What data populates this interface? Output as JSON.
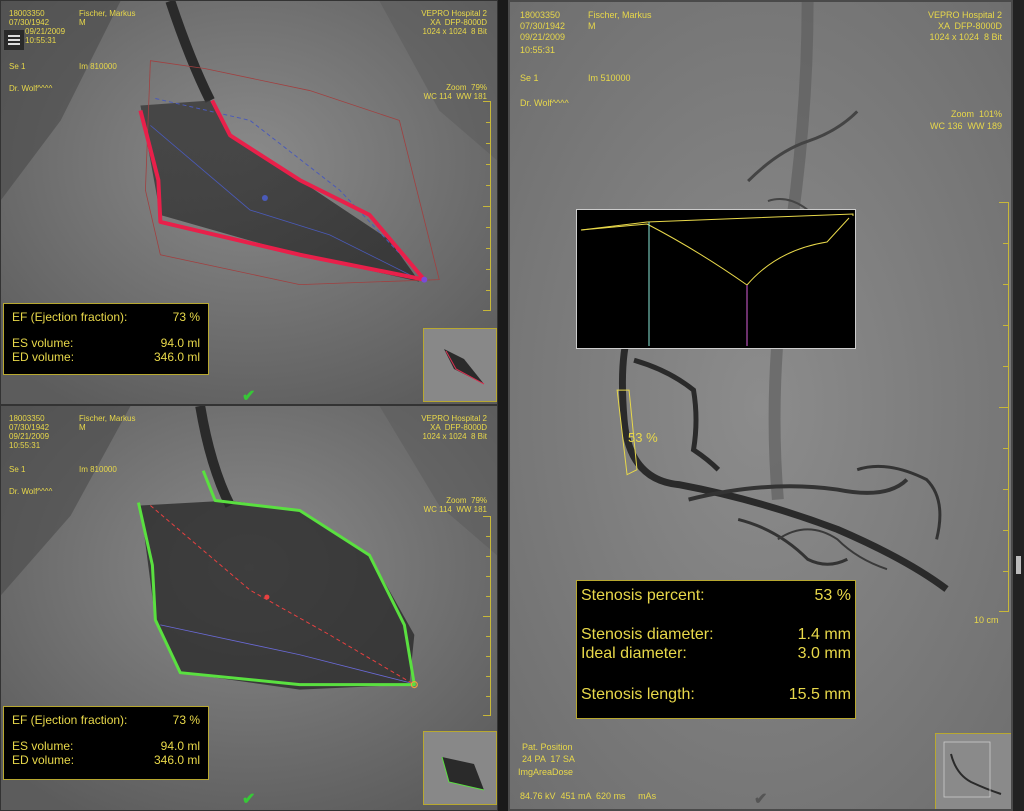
{
  "patient": {
    "id": "18003350",
    "name": "Fischer, Markus",
    "dob": "07/30/1942",
    "sex": "M",
    "date": "09/21/2009",
    "time": "10:55:31",
    "doctor": "Dr. Wolf^^^^"
  },
  "lv_panes": {
    "series": "Se 1",
    "image": "Im 810000",
    "hospital": "VEPRO Hospital 2",
    "device": "XA  DFP-8000D",
    "matrix": "1024 x 1024  8 Bit",
    "zoom": "Zoom  79%",
    "window": "WC 114  WW 181"
  },
  "lv_top": {
    "ef_label": "EF (Ejection fraction):",
    "ef_value": "73 %",
    "es_label": "ES volume:",
    "es_value": "94.0 ml",
    "ed_label": "ED volume:",
    "ed_value": "346.0 ml",
    "contour_color": "#e8204a"
  },
  "lv_bottom": {
    "ef_label": "EF (Ejection fraction):",
    "ef_value": "73 %",
    "es_label": "ES volume:",
    "es_value": "94.0 ml",
    "ed_label": "ED volume:",
    "ed_value": "346.0 ml",
    "contour_color": "#5ae040"
  },
  "coronary": {
    "series": "Se 1",
    "image": "Im 510000",
    "hospital": "VEPRO Hospital 2",
    "device": "XA  DFP-8000D",
    "matrix": "1024 x 1024  8 Bit",
    "zoom": "Zoom  101%",
    "window": "WC 136  WW 189",
    "stenosis_marker": "53 %",
    "scale_label": "10 cm",
    "stenosis_percent_label": "Stenosis percent:",
    "stenosis_percent_value": "53 %",
    "stenosis_diameter_label": "Stenosis diameter:",
    "stenosis_diameter_value": "1.4 mm",
    "ideal_diameter_label": "Ideal diameter:",
    "ideal_diameter_value": "3.0 mm",
    "stenosis_length_label": "Stenosis length:",
    "stenosis_length_value": "15.5 mm",
    "pat_position_label": "Pat. Position",
    "pat_position_value": "24 PA  17 SA",
    "img_area_dose": "ImgAreaDose",
    "exposure": "84.76 kV  451 mA  620 ms     mAs"
  },
  "icons": {
    "menu": "hamburger-menu-icon",
    "check": "checkmark-icon"
  }
}
